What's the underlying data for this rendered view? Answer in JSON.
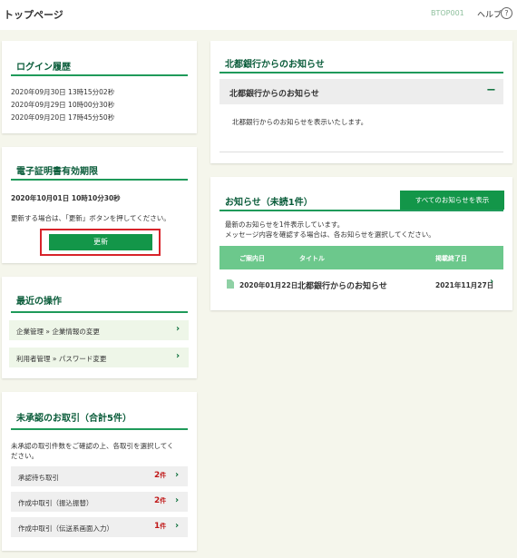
{
  "header": {
    "page_title": "トップページ",
    "screen_id": "BTOP001",
    "help_label": "ヘルプ",
    "help_icon": "?"
  },
  "login_history": {
    "title": "ログイン履歴",
    "entries": [
      "2020年09月30日 13時15分02秒",
      "2020年09月29日 10時00分30秒",
      "2020年09月20日 17時45分50秒"
    ]
  },
  "certificate": {
    "title": "電子証明書有効期限",
    "expiry": "2020年10月01日 10時10分30秒",
    "note": "更新する場合は、「更新」ボタンを押してください。",
    "update_button": "更新"
  },
  "recent_ops": {
    "title": "最近の操作",
    "items": [
      "企業管理 » 企業情報の変更",
      "利用者管理 » パスワード変更"
    ]
  },
  "pending": {
    "title": "未承認のお取引（合計5件）",
    "desc_line1": "未承認の取引件数をご確認の上、各取引を選択してく",
    "desc_line2": "ださい。",
    "items": [
      {
        "label": "承認待ち取引",
        "count": "2",
        "unit": "件"
      },
      {
        "label": "作成中取引（振込振替）",
        "count": "2",
        "unit": "件"
      },
      {
        "label": "作成中取引（伝送系画面入力）",
        "count": "1",
        "unit": "件"
      }
    ]
  },
  "bank_notice": {
    "title": "北都銀行からのお知らせ",
    "accordion_title": "北都銀行からのお知らせ",
    "accordion_toggle": "−",
    "body": "北都銀行からのお知らせを表示いたします。"
  },
  "notices": {
    "title": "お知らせ（未読1件）",
    "show_all_button": "すべてのお知らせを表示",
    "desc_line1": "最新のお知らせを1件表示しています。",
    "desc_line2": "メッセージ内容を確認する場合は、各お知らせを選択してください。",
    "columns": [
      "ご案内日",
      "タイトル",
      "掲載終了日"
    ],
    "rows": [
      {
        "date": "2020年01月22日",
        "title": "北都銀行からのお知らせ",
        "end_date": "2021年11月27日"
      }
    ]
  }
}
